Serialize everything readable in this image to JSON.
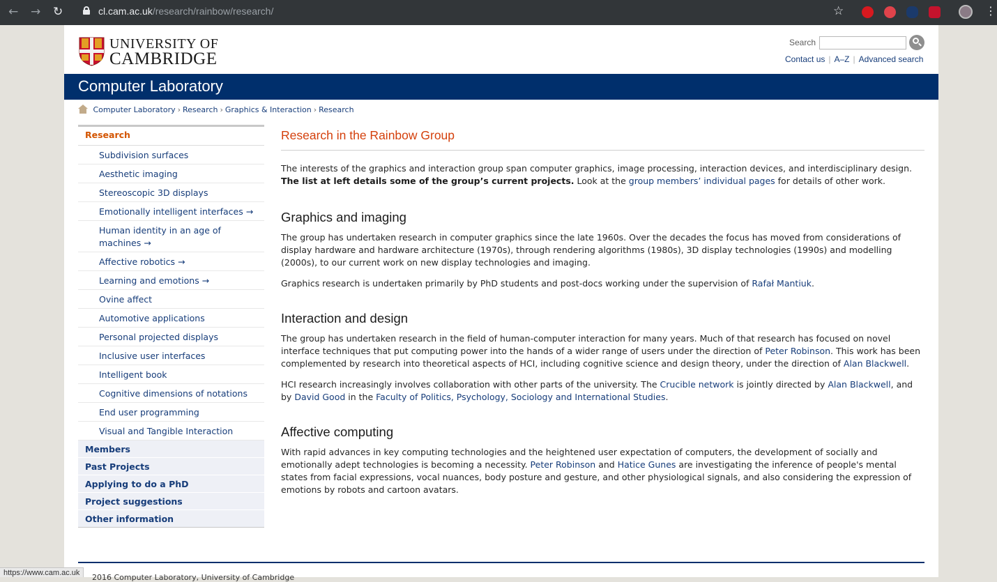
{
  "browser": {
    "url_host": "cl.cam.ac.uk",
    "url_path": "/research/rainbow/research/",
    "status_url": "https://www.cam.ac.uk"
  },
  "header": {
    "logo_line1": "UNIVERSITY OF",
    "logo_line2": "CAMBRIDGE",
    "search_label": "Search",
    "search_value": "",
    "links": [
      "Contact us",
      "A–Z",
      "Advanced search"
    ]
  },
  "banner": {
    "title": "Computer Laboratory"
  },
  "breadcrumb": [
    "Computer Laboratory",
    "Research",
    "Graphics & Interaction",
    "Research"
  ],
  "sidebar": {
    "heading": "Research",
    "items": [
      "Subdivision surfaces",
      "Aesthetic imaging",
      "Stereoscopic 3D displays",
      "Emotionally intelligent interfaces →",
      "Human identity in an age of machines →",
      "Affective robotics →",
      "Learning and emotions →",
      "Ovine affect",
      "Automotive applications",
      "Personal projected displays",
      "Inclusive user interfaces",
      "Intelligent book",
      "Cognitive dimensions of notations",
      "End user programming",
      "Visual and Tangible Interaction"
    ],
    "sections": [
      "Members",
      "Past Projects",
      "Applying to do a PhD",
      "Project suggestions",
      "Other information"
    ]
  },
  "main": {
    "title": "Research in the Rainbow Group",
    "intro": {
      "t1": "The interests of the graphics and interaction group span computer graphics, image processing, interaction devices, and interdisciplinary design. ",
      "bold": "The list at left details some of the group’s current projects.",
      "t2": " Look at the ",
      "link": "group members’ individual pages",
      "t3": " for details of other work."
    },
    "graphics": {
      "heading": "Graphics and imaging",
      "p1": "The group has undertaken research in computer graphics since the late 1960s. Over the decades the focus has moved from considerations of display hardware and hardware architecture (1970s), through rendering algorithms (1980s), 3D display technologies (1990s) and modelling (2000s), to our current work on new display technologies and imaging.",
      "p2_t1": "Graphics research is undertaken primarily by PhD students and post-docs working under the supervision of ",
      "p2_link": "Rafał Mantiuk",
      "p2_t2": "."
    },
    "interaction": {
      "heading": "Interaction and design",
      "p1_t1": "The group has undertaken research in the field of human-computer interaction for many years. Much of that research has focused on novel interface techniques that put computing power into the hands of a wider range of users under the direction of ",
      "p1_link1": "Peter Robinson",
      "p1_t2": ". This work has been complemented by research into theoretical aspects of HCI, including cognitive science and design theory, under the direction of ",
      "p1_link2": "Alan Blackwell",
      "p1_t3": ".",
      "p2_t1": "HCI research increasingly involves collaboration with other parts of the university. The ",
      "p2_link1": "Crucible network",
      "p2_t2": " is jointly directed by ",
      "p2_link2": "Alan Blackwell",
      "p2_t3": ", and by ",
      "p2_link3": "David Good",
      "p2_t4": " in the ",
      "p2_link4": "Faculty of Politics, Psychology, Sociology and International Studies",
      "p2_t5": "."
    },
    "affective": {
      "heading": "Affective computing",
      "p1_t1": "With rapid advances in key computing technologies and the heightened user expectation of computers, the development of socially and emotionally adept technologies is becoming a necessity. ",
      "p1_link1": "Peter Robinson",
      "p1_t2": " and ",
      "p1_link2": "Hatice Gunes",
      "p1_t3": " are investigating the inference of people's mental states from facial expressions, vocal nuances, body posture and gesture, and other physiological signals, and also considering the expression of emotions by robots and cartoon avatars."
    }
  },
  "footer": {
    "text": "2016 Computer Laboratory, University of Cambridge"
  }
}
